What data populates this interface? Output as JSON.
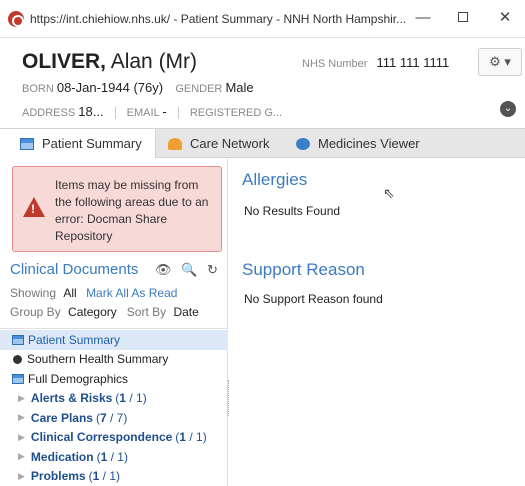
{
  "window": {
    "title": "https://int.chiehiow.nhs.uk/ - Patient Summary - NNH North Hampshir...",
    "minimize": "—",
    "close": "✕"
  },
  "patient": {
    "surname": "OLIVER,",
    "given": "Alan (Mr)",
    "nhs_label": "NHS Number",
    "nhs_value": "111 111 1111",
    "born_label": "BORN",
    "born_value": "08-Jan-1944 (76y)",
    "gender_label": "GENDER",
    "gender_value": "Male",
    "address_label": "ADDRESS",
    "address_value": "18...",
    "email_label": "EMAIL",
    "email_value": "-",
    "registered_label": "REGISTERED G...",
    "settings": "⚙ ▾",
    "expand": "⌄"
  },
  "tabs": [
    {
      "label": "Patient Summary",
      "icon": "summary-icon"
    },
    {
      "label": "Care Network",
      "icon": "people-icon"
    },
    {
      "label": "Medicines Viewer",
      "icon": "pill-icon"
    }
  ],
  "error": {
    "message": "Items may be missing from the following areas due to an error: Docman Share Repository",
    "icon": "warning-icon"
  },
  "clinical_documents": {
    "title": "Clinical Documents",
    "tools": [
      "👁",
      "🔍",
      "↻"
    ],
    "showing_label": "Showing",
    "showing_value": "All",
    "mark_all": "Mark All As Read",
    "group_by_label": "Group By",
    "group_by_value": "Category",
    "sort_by_label": "Sort By",
    "sort_by_value": "Date",
    "items": [
      {
        "label": "Patient Summary",
        "icon": "page-icon",
        "selected": true
      },
      {
        "label": "Southern Health Summary",
        "icon": "dot-icon"
      },
      {
        "label": "Full Demographics",
        "icon": "page-icon"
      }
    ],
    "groups": [
      {
        "name": "Alerts & Risks",
        "unread": "1",
        "total": "1"
      },
      {
        "name": "Care Plans",
        "unread": "7",
        "total": "7"
      },
      {
        "name": "Clinical Correspondence",
        "unread": "1",
        "total": "1"
      },
      {
        "name": "Medication",
        "unread": "1",
        "total": "1"
      },
      {
        "name": "Problems",
        "unread": "1",
        "total": "1"
      }
    ]
  },
  "main": {
    "allergies_title": "Allergies",
    "allergies_text": "No Results Found",
    "support_title": "Support Reason",
    "support_text": "No Support Reason found"
  }
}
